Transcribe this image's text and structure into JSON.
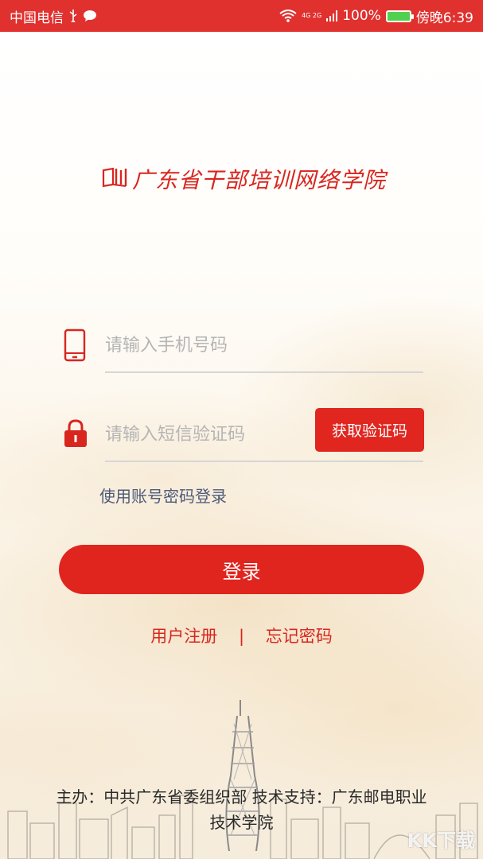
{
  "status_bar": {
    "carrier": "中国电信",
    "battery": "100%",
    "time": "傍晚6:39",
    "network": "4G 2G"
  },
  "app": {
    "logo_text": "广东省干部培训网络学院"
  },
  "form": {
    "phone_placeholder": "请输入手机号码",
    "code_placeholder": "请输入短信验证码",
    "get_code_label": "获取验证码",
    "alt_login_label": "使用账号密码登录",
    "login_label": "登录"
  },
  "links": {
    "register": "用户注册",
    "separator": "|",
    "forgot": "忘记密码"
  },
  "footer": {
    "line1": "主办：中共广东省委组织部 技术支持：广东邮电职业",
    "line2": "技术学院"
  },
  "watermark": "KK下载",
  "colors": {
    "brand_red": "#e0251f",
    "status_bar": "#e0312f",
    "link_blue": "#4d5a7a"
  }
}
